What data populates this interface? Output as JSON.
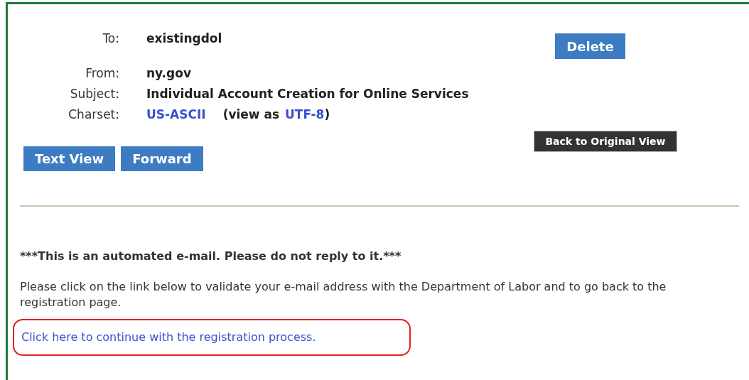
{
  "headers": [
    {
      "label": "To:",
      "parts": [
        {
          "kind": "text",
          "text": "existingdol"
        }
      ]
    },
    {
      "label": "From:",
      "parts": [
        {
          "kind": "text",
          "text": "ny.gov"
        }
      ]
    },
    {
      "label": "Subject:",
      "parts": [
        {
          "kind": "text",
          "text": "Individual Account Creation for Online Services"
        }
      ]
    },
    {
      "label": "Charset:",
      "parts": [
        {
          "kind": "link",
          "text": "US-ASCII"
        },
        {
          "kind": "text",
          "text": "(view as"
        },
        {
          "kind": "link",
          "text": "UTF-8"
        },
        {
          "kind": "text",
          "text": ")"
        }
      ]
    }
  ],
  "delete_button": "Delete",
  "back_button": "Back to Original View",
  "view_buttons": [
    "Text View",
    "Forward"
  ],
  "body": {
    "notice": "***This is an automated e-mail. Please do not reply to it.***",
    "paragraph": "Please click on the link below to validate your e-mail address with the Department of Labor and to go back to the registration page.",
    "link": {
      "text": "Click here to continue with the registration process.",
      "highlighted": true
    }
  }
}
